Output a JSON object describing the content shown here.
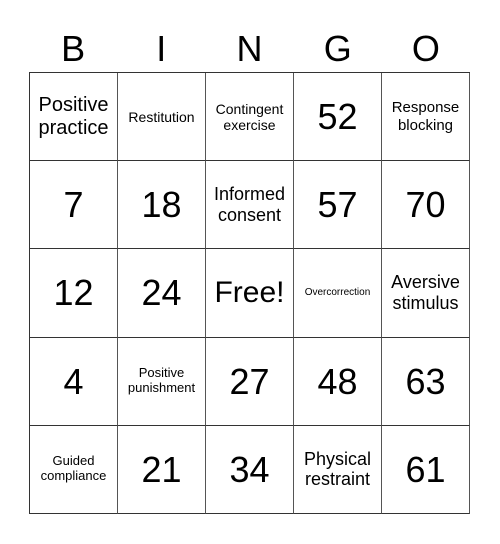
{
  "card": {
    "header": [
      "B",
      "I",
      "N",
      "G",
      "O"
    ],
    "rows": [
      [
        "Positive practice",
        "Restitution",
        "Contingent exercise",
        "52",
        "Response blocking"
      ],
      [
        "7",
        "18",
        "Informed consent",
        "57",
        "70"
      ],
      [
        "12",
        "24",
        "Free!",
        "Overcorrection",
        "Aversive stimulus"
      ],
      [
        "4",
        "Positive punishment",
        "27",
        "48",
        "63"
      ],
      [
        "Guided compliance",
        "21",
        "34",
        "Physical restraint",
        "61"
      ]
    ]
  }
}
